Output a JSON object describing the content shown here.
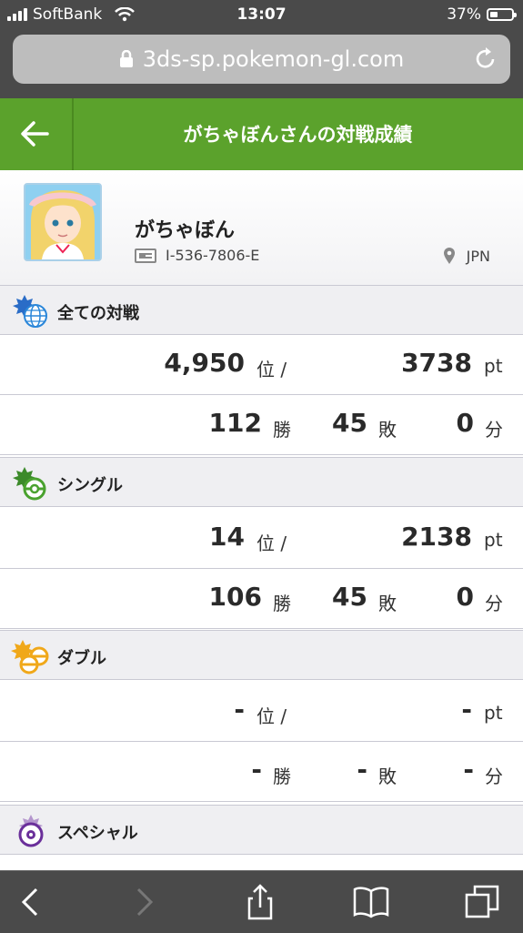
{
  "status_bar": {
    "carrier": "SoftBank",
    "time": "13:07",
    "battery": "37%",
    "battery_level": 0.37
  },
  "browser": {
    "url": "3ds-sp.pokemon-gl.com"
  },
  "header": {
    "title": "がちゃぼんさんの対戦成績"
  },
  "profile": {
    "name": "がちゃぼん",
    "id": "I-536-7806-E",
    "country": "JPN"
  },
  "sections": [
    {
      "label": "全ての対戦",
      "rank": "4,950",
      "rank_unit": "位 /",
      "points": "3738",
      "points_unit": "pt",
      "wins": "112",
      "wins_unit": "勝",
      "losses": "45",
      "losses_unit": "敗",
      "draws": "0",
      "draws_unit": "分"
    },
    {
      "label": "シングル",
      "rank": "14",
      "rank_unit": "位 /",
      "points": "2138",
      "points_unit": "pt",
      "wins": "106",
      "wins_unit": "勝",
      "losses": "45",
      "losses_unit": "敗",
      "draws": "0",
      "draws_unit": "分"
    },
    {
      "label": "ダブル",
      "rank": "-",
      "rank_unit": "位 /",
      "points": "-",
      "points_unit": "pt",
      "wins": "-",
      "wins_unit": "勝",
      "losses": "-",
      "losses_unit": "敗",
      "draws": "-",
      "draws_unit": "分"
    },
    {
      "label": "スペシャル"
    }
  ],
  "colors": {
    "header_green": "#5ba22c",
    "chrome": "#4a4a4a",
    "section_bg": "#efeff2"
  }
}
